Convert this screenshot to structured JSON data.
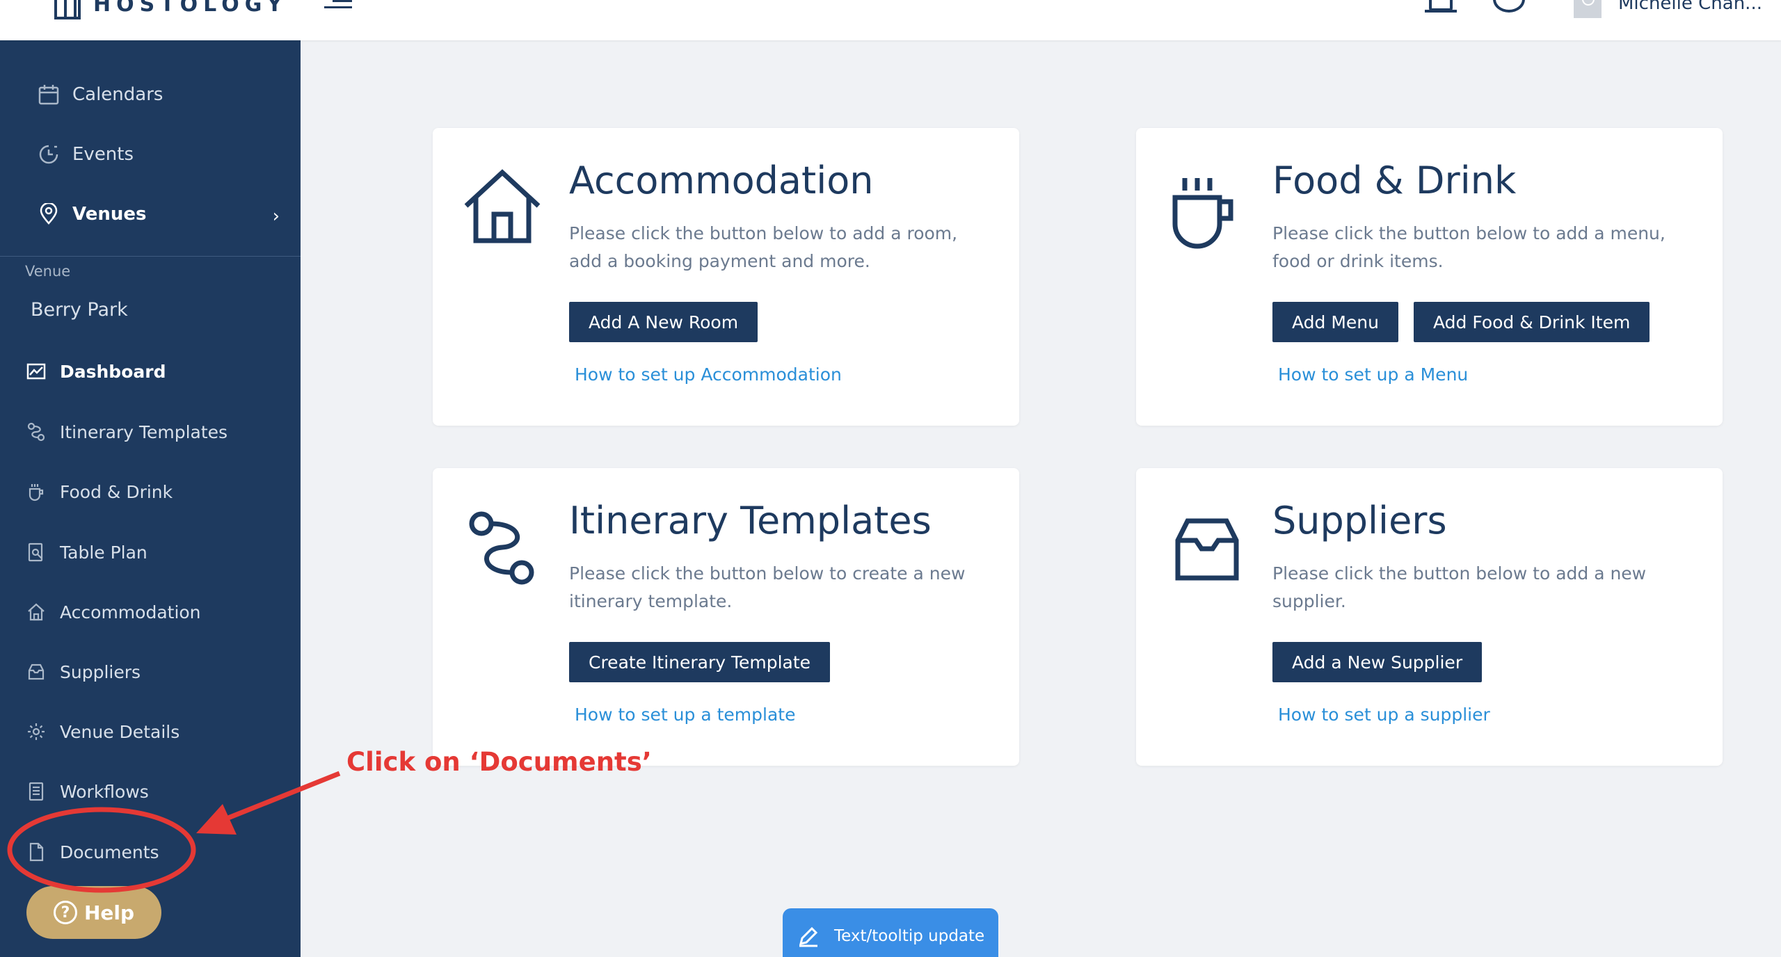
{
  "brand": {
    "logo_text": "HOSTOLOGY"
  },
  "header": {
    "user_name": "Michelle Chan..."
  },
  "sidebar": {
    "top_items": [
      {
        "label": "Calendars",
        "icon": "calendar-icon"
      },
      {
        "label": "Events",
        "icon": "events-icon"
      },
      {
        "label": "Venues",
        "icon": "location-pin-icon"
      }
    ],
    "section_label": "Venue",
    "venue_name": "Berry Park",
    "venue_items": [
      {
        "label": "Dashboard",
        "icon": "chart-icon"
      },
      {
        "label": "Itinerary Templates",
        "icon": "route-icon"
      },
      {
        "label": "Food & Drink",
        "icon": "cup-icon"
      },
      {
        "label": "Table Plan",
        "icon": "table-plan-icon"
      },
      {
        "label": "Accommodation",
        "icon": "home-icon"
      },
      {
        "label": "Suppliers",
        "icon": "inbox-icon"
      },
      {
        "label": "Venue Details",
        "icon": "gear-icon"
      },
      {
        "label": "Workflows",
        "icon": "workflow-icon"
      },
      {
        "label": "Documents",
        "icon": "document-icon"
      }
    ],
    "help_label": "Help"
  },
  "cards": {
    "accommodation": {
      "title": "Accommodation",
      "description": "Please click the button below to add a room, add a booking payment and more.",
      "button": "Add A New Room",
      "link": "How to set up Accommodation"
    },
    "food_drink": {
      "title": "Food & Drink",
      "description": "Please click the button below to add a menu, food or drink items.",
      "button": "Add Menu",
      "button2": "Add Food & Drink Item",
      "link": "How to set up a Menu"
    },
    "itinerary": {
      "title": "Itinerary Templates",
      "description": "Please click the button below to create a new itinerary template.",
      "button": "Create Itinerary Template",
      "link": "How to set up a template"
    },
    "suppliers": {
      "title": "Suppliers",
      "description": "Please click the button below to add a new supplier.",
      "button": "Add a New Supplier",
      "link": "How to set up a supplier"
    }
  },
  "annotation": {
    "text": "Click on ‘Documents’",
    "color": "#e53935"
  },
  "floating": {
    "label": "Text/tooltip update"
  },
  "colors": {
    "navy": "#1e3a5f",
    "link": "#2a8fd8",
    "help": "#c8a96e",
    "accent": "#3a8ee6"
  }
}
